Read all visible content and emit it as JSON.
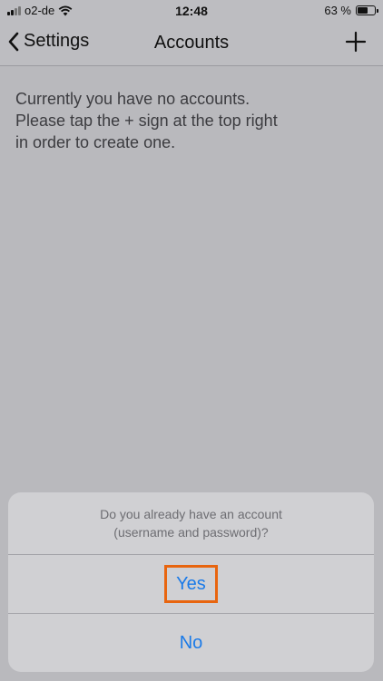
{
  "status_bar": {
    "carrier": "o2-de",
    "time": "12:48",
    "battery_text": "63 %",
    "battery_level": 0.63,
    "signal_bars": 4,
    "signal_active": 2
  },
  "nav": {
    "back_label": "Settings",
    "title": "Accounts",
    "add_icon": "plus-icon"
  },
  "content": {
    "empty_message": "Currently you have no accounts.\nPlease tap the + sign at the top right\nin order to create one."
  },
  "dialog": {
    "message": "Do you already have an account\n(username and password)?",
    "yes_label": "Yes",
    "no_label": "No",
    "highlight_color": "#e8650f",
    "button_color": "#1a7ae8"
  }
}
